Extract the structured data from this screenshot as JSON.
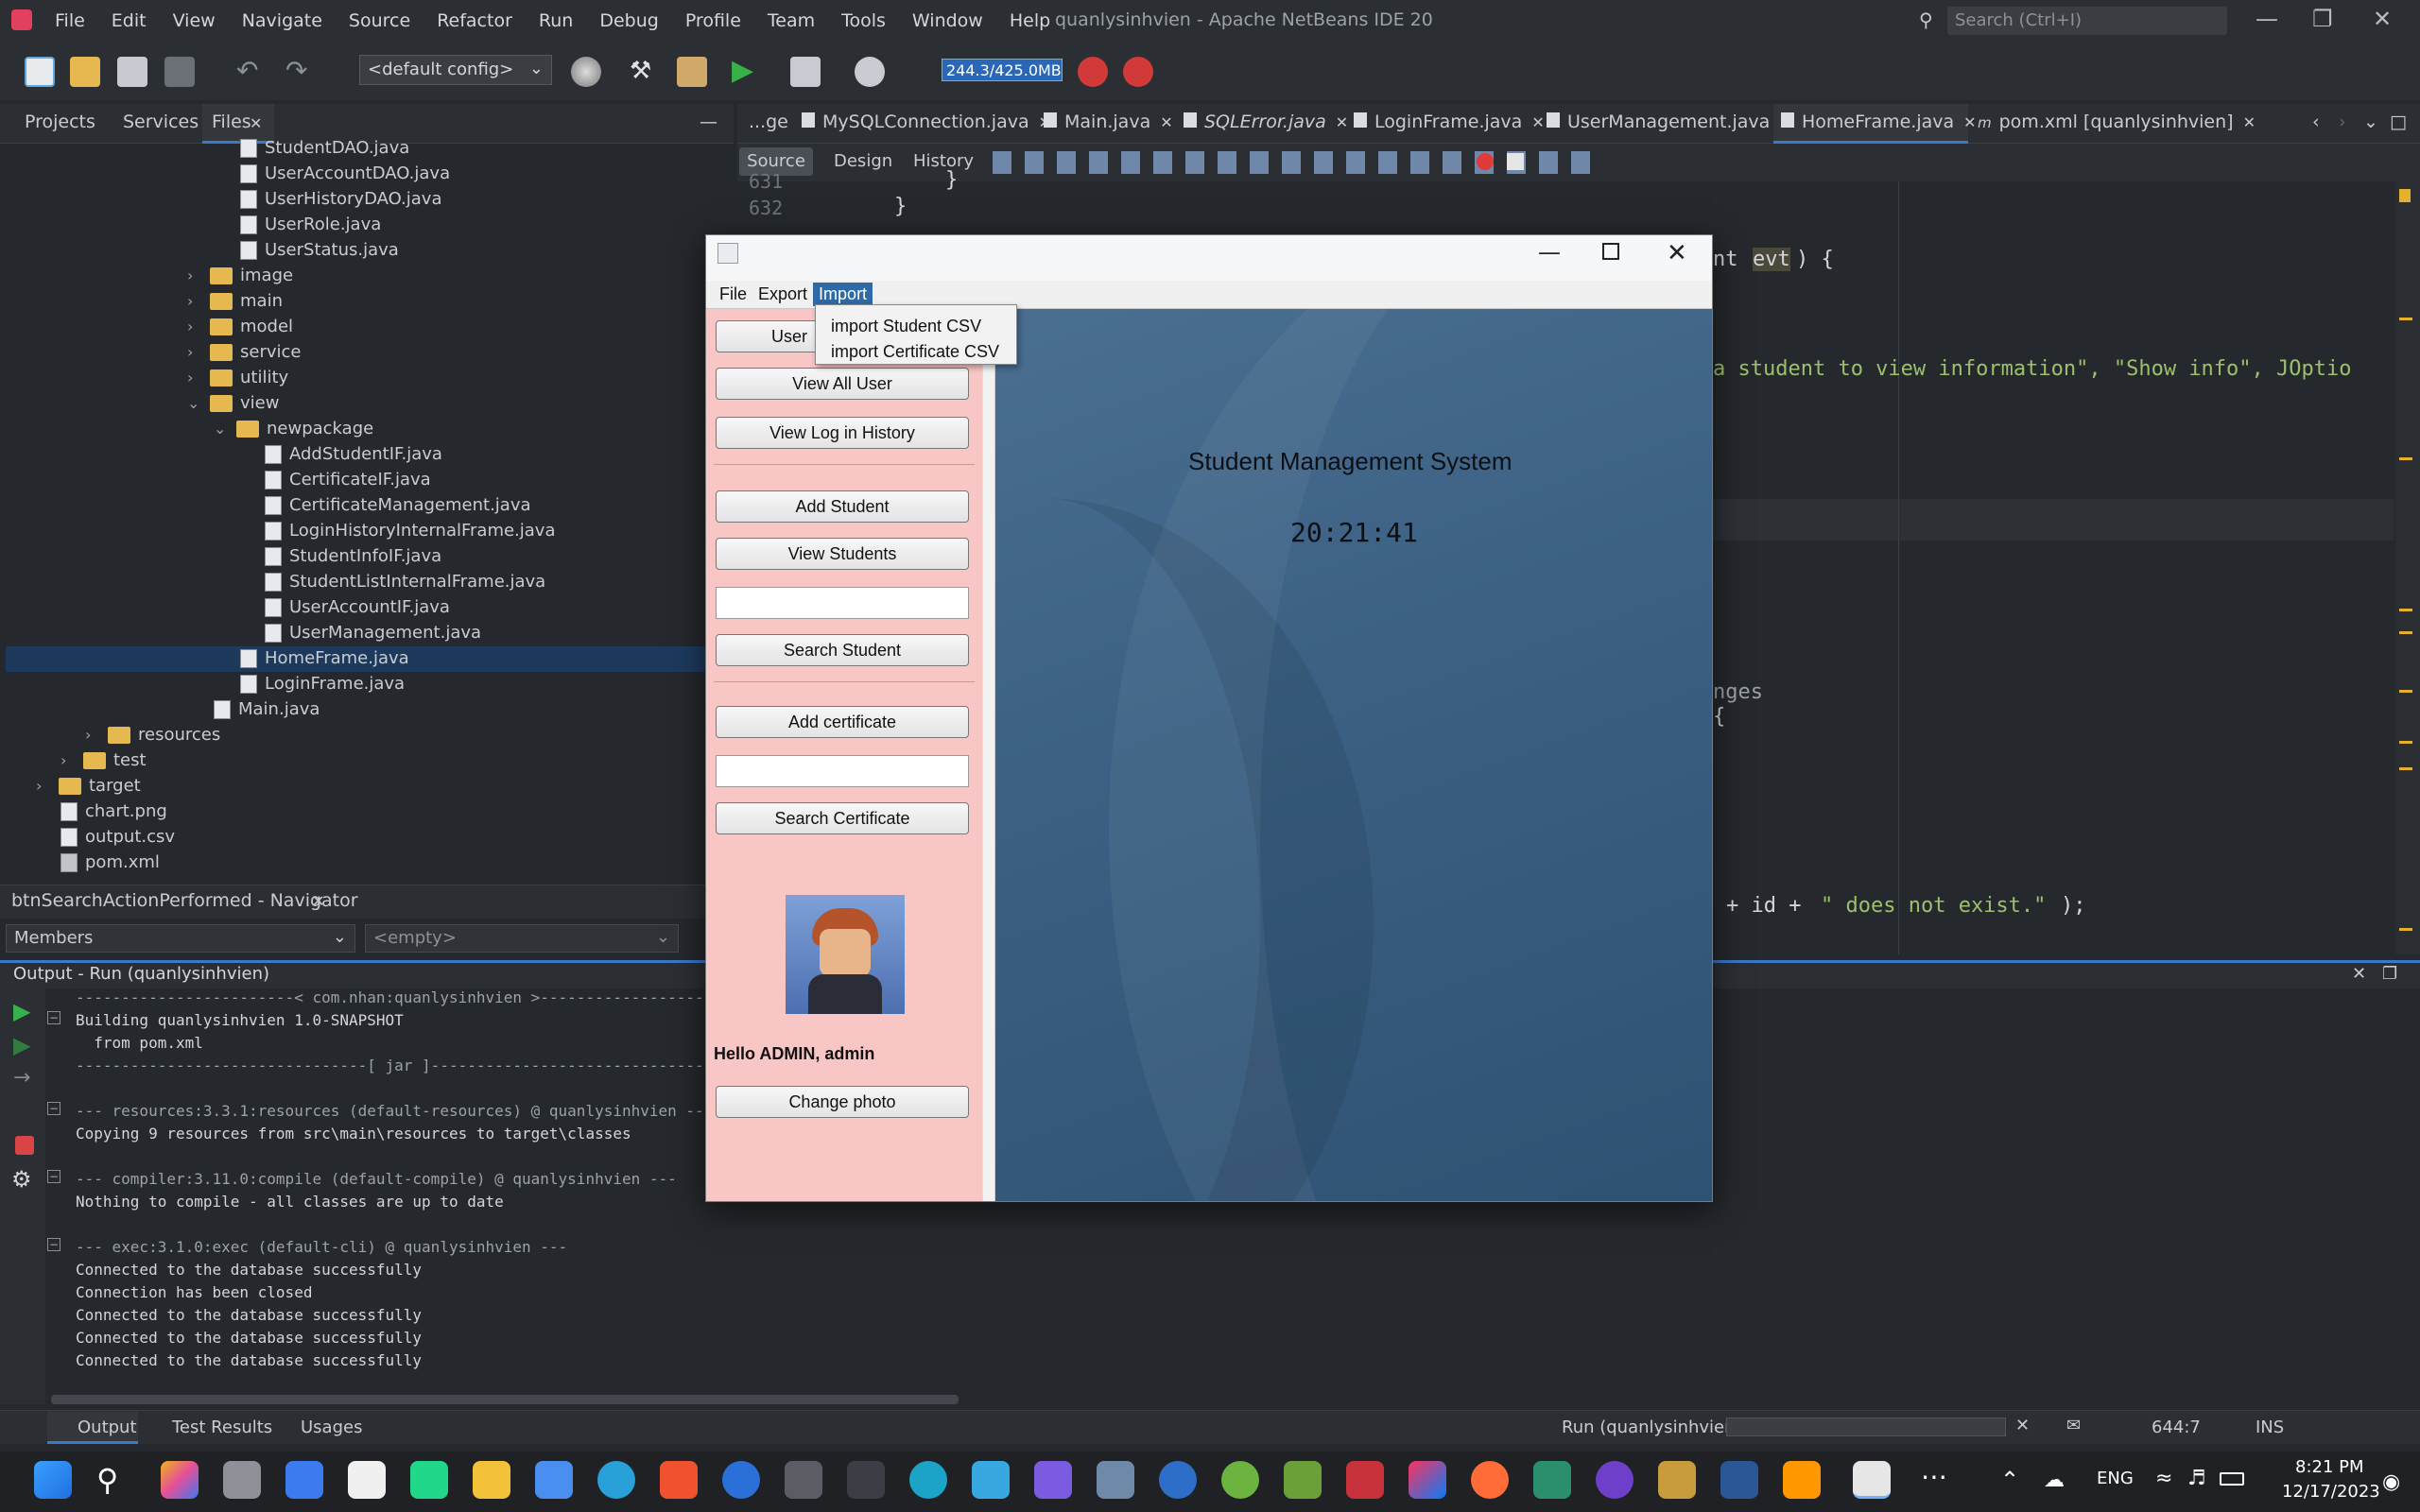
{
  "ide": {
    "title": "quanlysinhvien - Apache NetBeans IDE 20",
    "menu": [
      "File",
      "Edit",
      "View",
      "Navigate",
      "Source",
      "Refactor",
      "Run",
      "Debug",
      "Profile",
      "Team",
      "Tools",
      "Window",
      "Help"
    ],
    "search_placeholder": "Search (Ctrl+I)",
    "config": "<default config>",
    "memory": "244.3/425.0MB"
  },
  "left_panel": {
    "tabs": [
      "Projects",
      "Services",
      "Files"
    ],
    "tree": [
      {
        "label": "StudentDAO.java",
        "type": "file"
      },
      {
        "label": "UserAccountDAO.java",
        "type": "file"
      },
      {
        "label": "UserHistoryDAO.java",
        "type": "file"
      },
      {
        "label": "UserRole.java",
        "type": "file"
      },
      {
        "label": "UserStatus.java",
        "type": "file"
      },
      {
        "label": "image",
        "type": "folder"
      },
      {
        "label": "main",
        "type": "folder"
      },
      {
        "label": "model",
        "type": "folder"
      },
      {
        "label": "service",
        "type": "folder"
      },
      {
        "label": "utility",
        "type": "folder"
      },
      {
        "label": "view",
        "type": "folder-open"
      },
      {
        "label": "newpackage",
        "type": "folder-open"
      },
      {
        "label": "AddStudentIF.java",
        "type": "file"
      },
      {
        "label": "CertificateIF.java",
        "type": "file"
      },
      {
        "label": "CertificateManagement.java",
        "type": "file"
      },
      {
        "label": "LoginHistoryInternalFrame.java",
        "type": "file"
      },
      {
        "label": "StudentInfoIF.java",
        "type": "file"
      },
      {
        "label": "StudentListInternalFrame.java",
        "type": "file"
      },
      {
        "label": "UserAccountIF.java",
        "type": "file"
      },
      {
        "label": "UserManagement.java",
        "type": "file"
      },
      {
        "label": "HomeFrame.java",
        "type": "file"
      },
      {
        "label": "LoginFrame.java",
        "type": "file"
      },
      {
        "label": "Main.java",
        "type": "file"
      },
      {
        "label": "resources",
        "type": "folder"
      },
      {
        "label": "test",
        "type": "folder"
      },
      {
        "label": "target",
        "type": "folder"
      },
      {
        "label": "chart.png",
        "type": "file"
      },
      {
        "label": "output.csv",
        "type": "file"
      },
      {
        "label": "pom.xml",
        "type": "file"
      }
    ],
    "navigator_title": "btnSearchActionPerformed - Navigator",
    "members": "Members",
    "empty": "<empty>"
  },
  "editor": {
    "tabs": [
      "...ge",
      "MySQLConnection.java",
      "Main.java",
      "SQLError.java",
      "LoginFrame.java",
      "UserManagement.java",
      "HomeFrame.java",
      "pom.xml [quanlysinhvien]"
    ],
    "views": [
      "Source",
      "Design",
      "History"
    ],
    "line_numbers": [
      "631",
      "632"
    ],
    "code": {
      "brace1": "}",
      "brace2": "}",
      "l1a": "nt ",
      "l1b": "evt",
      "l1c": ") {",
      "l2a": "a student to view information\", \"Show info\", JOptio",
      "l3": "nges",
      "l4": "{",
      "l5a": "+ id + ",
      "l5b": "\" does not exist.\"",
      "l5c": ");"
    }
  },
  "output": {
    "title": "Output - Run (quanlysinhvien)",
    "lines": [
      "------------------------< com.nhan:quanlysinhvien >------------------------",
      "Building quanlysinhvien 1.0-SNAPSHOT",
      "  from pom.xml",
      "--------------------------------[ jar ]---------------------------------",
      "",
      "--- resources:3.3.1:resources (default-resources) @ quanlysinhvien ---",
      "Copying 9 resources from src\\main\\resources to target\\classes",
      "",
      "--- compiler:3.11.0:compile (default-compile) @ quanlysinhvien ---",
      "Nothing to compile - all classes are up to date",
      "",
      "--- exec:3.1.0:exec (default-cli) @ quanlysinhvien ---",
      "Connected to the database successfully",
      "Connection has been closed",
      "Connected to the database successfully",
      "Connected to the database successfully",
      "Connected to the database successfully"
    ]
  },
  "statusbar": {
    "tabs": [
      "Output",
      "Test Results",
      "Usages"
    ],
    "run": "Run (quanlysinhvien)",
    "position": "644:7",
    "mode": "INS"
  },
  "app": {
    "menu": [
      "File",
      "Export",
      "Import"
    ],
    "import_items": [
      "import Student CSV",
      "import Certificate CSV"
    ],
    "buttons": {
      "user": "User",
      "view_all_user": "View All User",
      "view_log": "View Log in History",
      "add_student": "Add Student",
      "view_students": "View Students",
      "search_student": "Search Student",
      "add_certificate": "Add certificate",
      "search_certificate": "Search Certificate",
      "change_photo": "Change photo"
    },
    "greeting": "Hello ADMIN, admin",
    "heading": "Student Management System",
    "clock": "20:21:41"
  },
  "taskbar": {
    "lang": "ENG",
    "time": "8:21 PM",
    "date": "12/17/2023"
  }
}
